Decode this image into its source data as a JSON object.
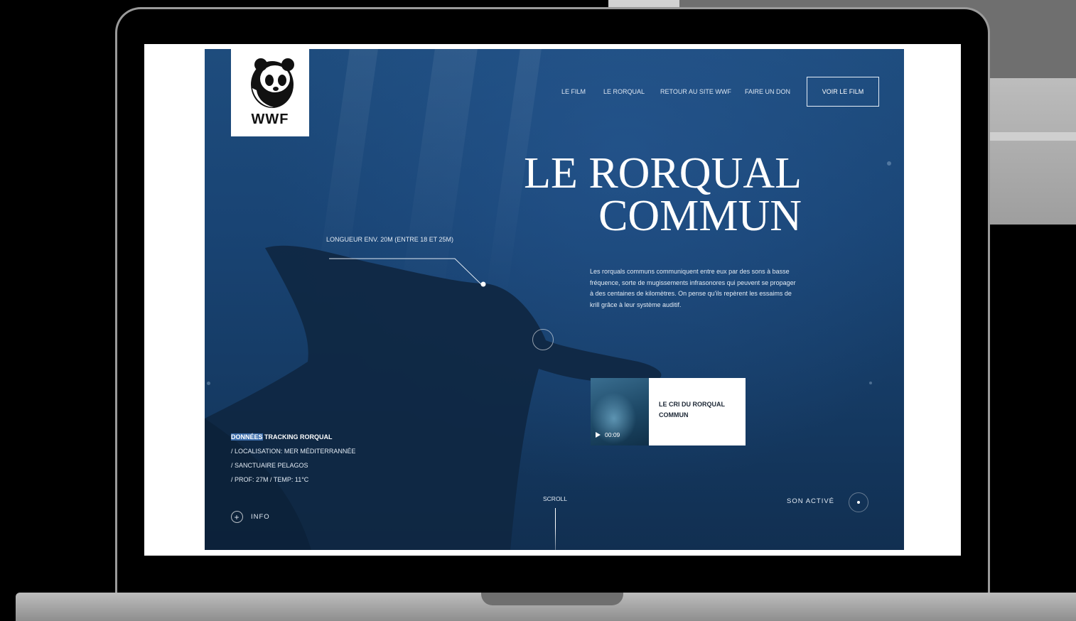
{
  "brand": {
    "logo_text": "WWF"
  },
  "nav": {
    "items": [
      "LE FILM",
      "LE RORQUAL",
      "RETOUR AU SITE WWF",
      "FAIRE UN DON"
    ],
    "cta": "VOIR LE FILM"
  },
  "hero": {
    "title_line1": "LE RORQUAL",
    "title_line2": "COMMUN",
    "description": "Les rorquals communs communiquent entre eux par des sons à basse fréquence, sorte de mugissements infrasonores qui peuvent se propager à des centaines de kilomètres. On pense qu'ils repèrent les essaims de krill grâce à leur système auditif."
  },
  "annotation": {
    "length": "LONGUEUR ENV. 20M (ENTRE 18 ET 25M)"
  },
  "video": {
    "title": "LE CRI DU RORQUAL COMMUN",
    "duration": "00:09"
  },
  "tracking": {
    "title_highlight": "DONNÉES",
    "title_rest": " TRACKING RORQUAL",
    "lines": [
      "/ LOCALISATION: MER MÉDITERRANNÉE",
      "/ SANCTUAIRE PELAGOS",
      "/ PROF: 27M / TEMP: 11°C"
    ]
  },
  "controls": {
    "info": "INFO",
    "scroll": "SCROLL",
    "sound": "SON ACTIVÉ"
  },
  "colors": {
    "ocean": "#194474",
    "white": "#ffffff",
    "highlight": "#3b6dab"
  }
}
